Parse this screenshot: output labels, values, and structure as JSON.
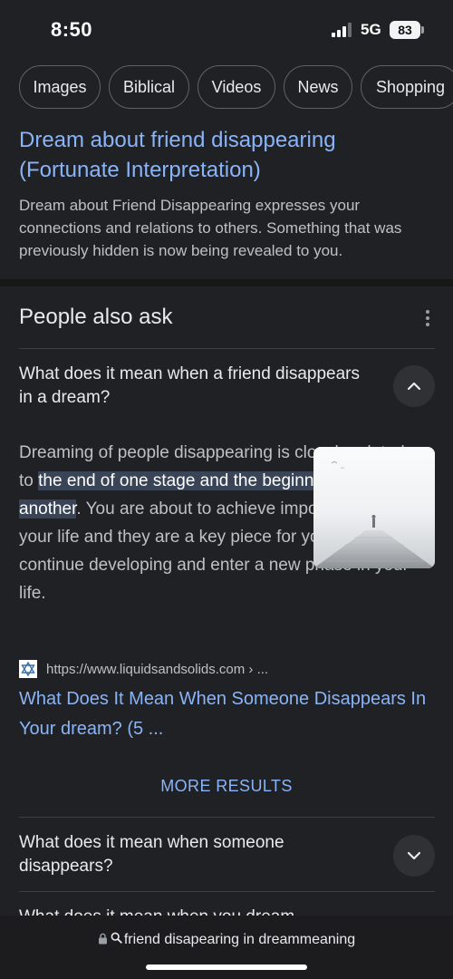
{
  "status_bar": {
    "time": "8:50",
    "network": "5G",
    "battery": "83"
  },
  "chips": [
    "Images",
    "Biblical",
    "Videos",
    "News",
    "Shopping"
  ],
  "result": {
    "title": "Dream about friend disappearing (Fortunate Interpretation)",
    "snippet": "Dream about Friend Disappearing expresses your connections and relations to others. Something that was previously hidden is now being revealed to you."
  },
  "paa": {
    "heading": "People also ask",
    "questions": [
      {
        "text": "What does it mean when a friend disappears in a dream?",
        "expanded": true
      },
      {
        "text": "What does it mean when someone disappears?",
        "expanded": false
      },
      {
        "text": "What does it mean when you dream",
        "expanded": false
      }
    ],
    "answer": {
      "before": "Dreaming of people disappearing is closely related to ",
      "highlight": "the end of one stage and the beginning of another",
      "after": ". You are about to achieve important goals in your life and they are a key piece for you to continue developing and enter a new phase in your life."
    },
    "source": {
      "url": "https://www.liquidsandsolids.com › ...",
      "link_title": "What Does It Mean When Someone Disappears In Your dream? (5 ..."
    },
    "more_results": "MORE RESULTS"
  },
  "url_bar": {
    "query": "friend disapearing in dreammeaning"
  },
  "icons": {
    "signal": "cellular-signal-icon",
    "more": "more-vert-icon",
    "collapse": "chevron-up-icon",
    "expand": "chevron-down-icon",
    "lock": "lock-icon",
    "search": "search-icon"
  },
  "colors": {
    "background": "#202124",
    "link": "#8ab4f8",
    "highlight": "#394457"
  }
}
